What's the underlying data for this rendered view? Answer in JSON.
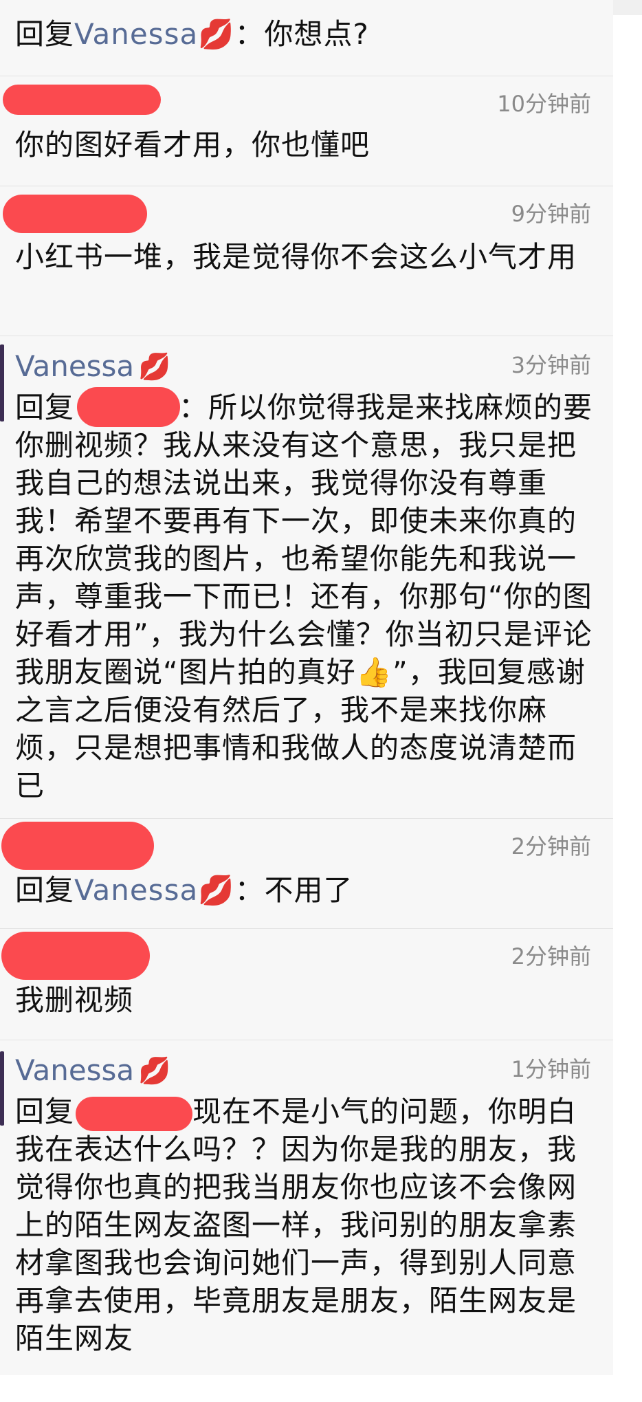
{
  "comments": [
    {
      "reply_prefix": "回复",
      "reply_to": "Vanessa",
      "reply_emoji": "💋",
      "text": "：你想点?"
    },
    {
      "time": "10分钟前",
      "text": "你的图好看才用，你也懂吧"
    },
    {
      "time": "9分钟前",
      "text": "小红书一堆，我是觉得你不会这么小气才用"
    },
    {
      "name": "Vanessa",
      "emoji": "💋",
      "time": "3分钟前",
      "reply_prefix": "回复",
      "text": "：所以你觉得我是来找麻烦的要你删视频？我从来没有这个意思，我只是把我自己的想法说出来，我觉得你没有尊重我！希望不要再有下一次，即使未来你真的再次欣赏我的图片，也希望你能先和我说一声，尊重我一下而已！还有，你那句“你的图好看才用”，我为什么会懂？你当初只是评论我朋友圈说“图片拍的真好👍”，我回复感谢之言之后便没有然后了，我不是来找你麻烦，只是想把事情和我做人的态度说清楚而已"
    },
    {
      "time": "2分钟前",
      "reply_prefix": "回复",
      "reply_to": "Vanessa",
      "reply_emoji": "💋",
      "text": "：不用了"
    },
    {
      "time": "2分钟前",
      "text": "我删视频"
    },
    {
      "name": "Vanessa",
      "emoji": "💋",
      "time": "1分钟前",
      "reply_prefix": "回复",
      "text": "现在不是小气的问题，你明白我在表达什么吗？？因为你是我的朋友，我觉得你也真的把我当朋友你也应该不会像网上的陌生网友盗图一样，我问别的朋友拿素材拿图我也会询问她们一声，得到别人同意再拿去使用，毕竟朋友是朋友，陌生网友是陌生网友"
    }
  ]
}
